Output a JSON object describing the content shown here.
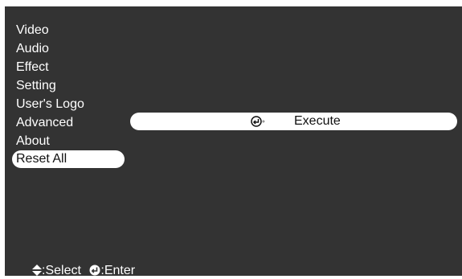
{
  "menu": {
    "items": [
      {
        "label": "Video"
      },
      {
        "label": "Audio"
      },
      {
        "label": "Effect"
      },
      {
        "label": "Setting"
      },
      {
        "label": "User's Logo"
      },
      {
        "label": "Advanced"
      },
      {
        "label": "About"
      },
      {
        "label": "Reset All",
        "selected": true
      }
    ]
  },
  "submenu": {
    "action_label": "Execute",
    "icon": "enter-arrow-icon"
  },
  "footer": {
    "select_label": ":Select",
    "enter_label": ":Enter",
    "select_icon": "up-down-arrows-icon",
    "enter_icon": "enter-icon"
  },
  "colors": {
    "background": "#333333",
    "highlight": "#ffffff",
    "text": "#ffffff"
  }
}
